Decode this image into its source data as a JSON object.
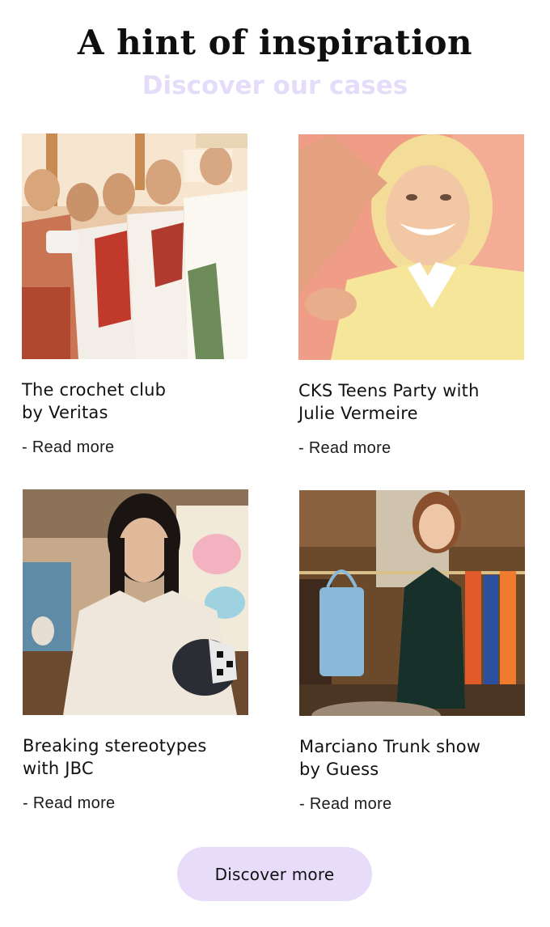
{
  "header": {
    "title": "A hint of inspiration",
    "subtitle": "Discover our cases"
  },
  "cases": [
    {
      "name_line1": "The crochet club",
      "name_line2": "by Veritas",
      "link_label": "- Read more"
    },
    {
      "name_line1": "CKS Teens Party with",
      "name_line2": "Julie Vermeire",
      "link_label": "- Read more"
    },
    {
      "name_line1": "Breaking stereotypes",
      "name_line2": "with JBC",
      "link_label": "- Read more"
    },
    {
      "name_line1": "Marciano Trunk show",
      "name_line2": "by Guess",
      "link_label": "- Read more"
    }
  ],
  "cta": {
    "label": "Discover more"
  },
  "colors": {
    "subtitle": "#e4dcf8",
    "button_bg": "#e7ddfb",
    "text": "#111111"
  }
}
